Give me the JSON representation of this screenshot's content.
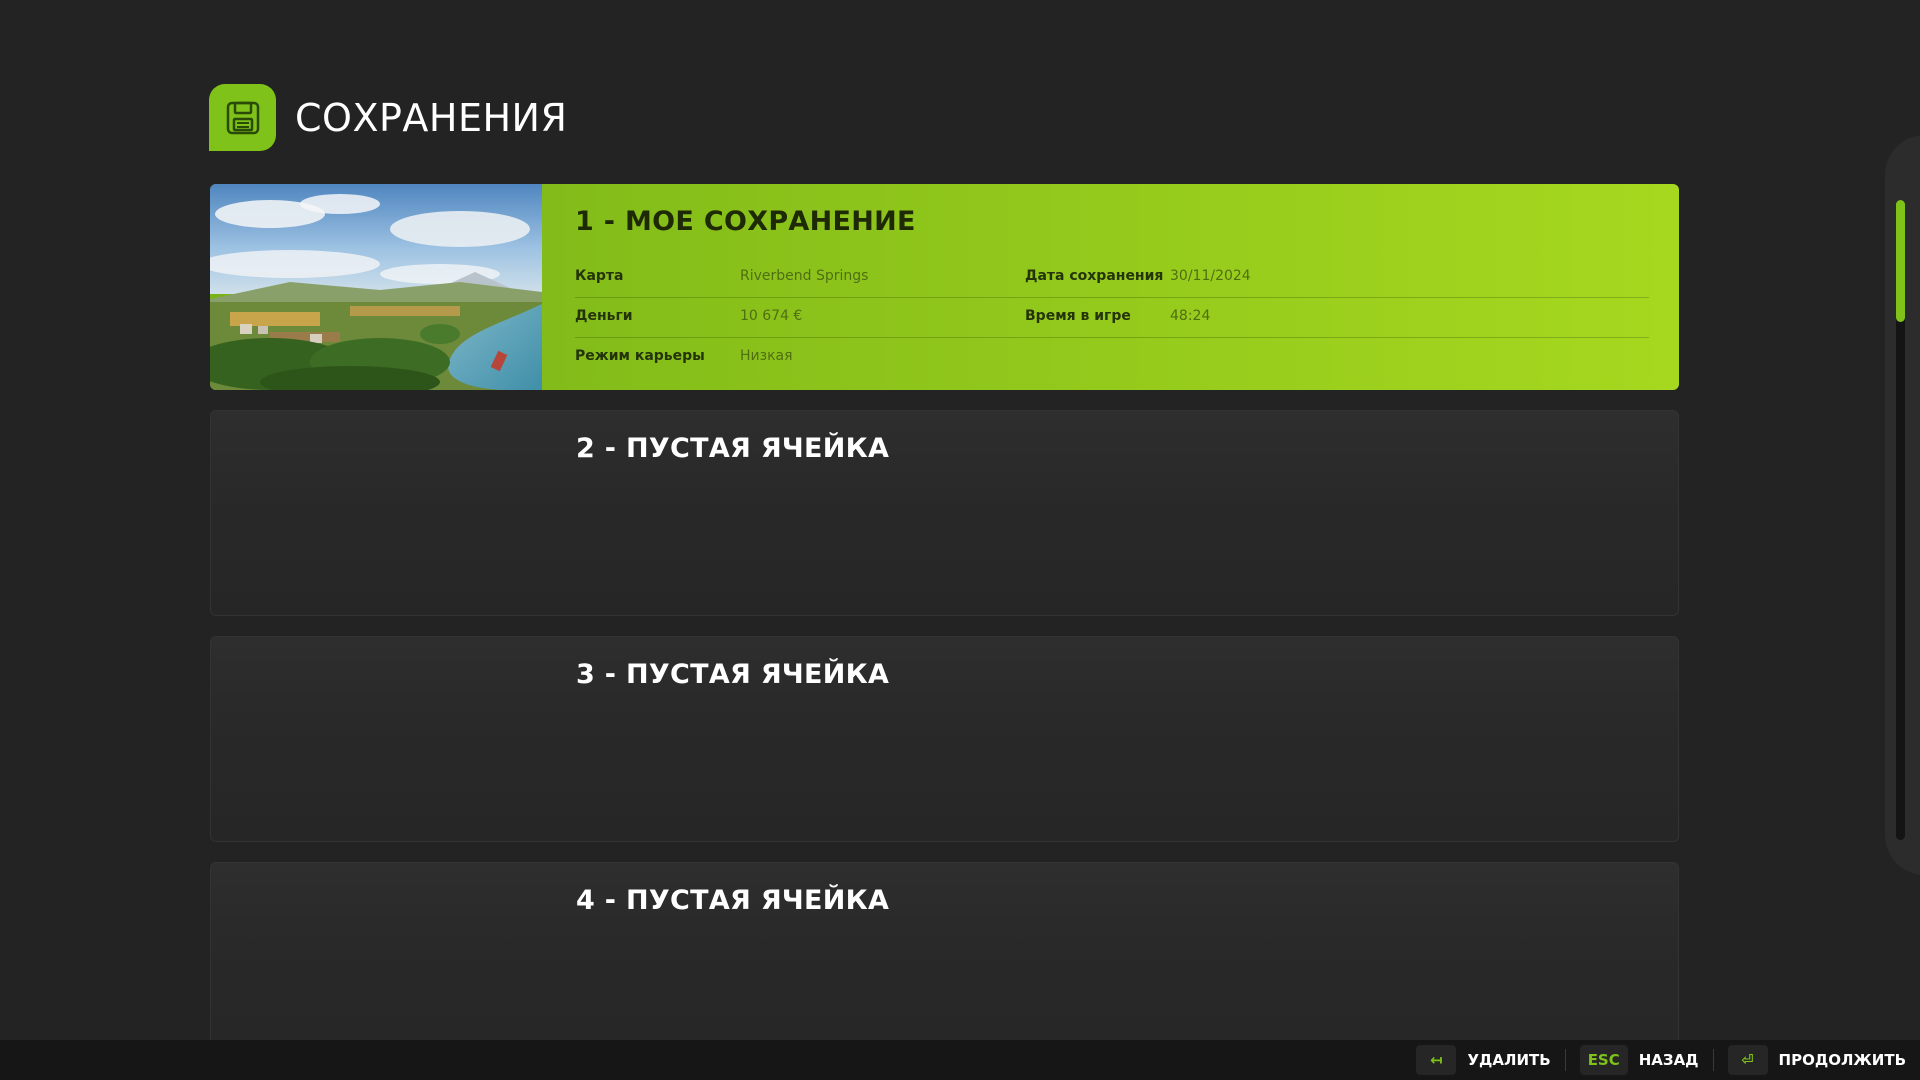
{
  "header": {
    "title": "СОХРАНЕНИЯ",
    "icon": "floppy-disk-icon",
    "accent_color": "#7fc21a"
  },
  "slots": [
    {
      "title": "1 - МОЕ СОХРАНЕНИЕ",
      "selected": true,
      "has_thumbnail": true,
      "info": {
        "map_label": "Карта",
        "map_value": "Riverbend Springs",
        "date_label": "Дата сохранения",
        "date_value": "30/11/2024",
        "money_label": "Деньги",
        "money_value": "10 674 €",
        "playtime_label": "Время в игре",
        "playtime_value": "48:24",
        "mode_label": "Режим карьеры",
        "mode_value": "Низкая"
      }
    },
    {
      "title": "2 - ПУСТАЯ ЯЧЕЙКА",
      "selected": false
    },
    {
      "title": "3 - ПУСТАЯ ЯЧЕЙКА",
      "selected": false
    },
    {
      "title": "4 - ПУСТАЯ ЯЧЕЙКА",
      "selected": false
    }
  ],
  "scrollbar": {
    "visible_fraction": 0.19
  },
  "footer": {
    "delete": {
      "key": "↤",
      "label": "УДАЛИТЬ"
    },
    "back": {
      "key": "ESC",
      "label": "НАЗАД"
    },
    "continue": {
      "key": "⏎",
      "label": "ПРОДОЛЖИТЬ"
    }
  }
}
